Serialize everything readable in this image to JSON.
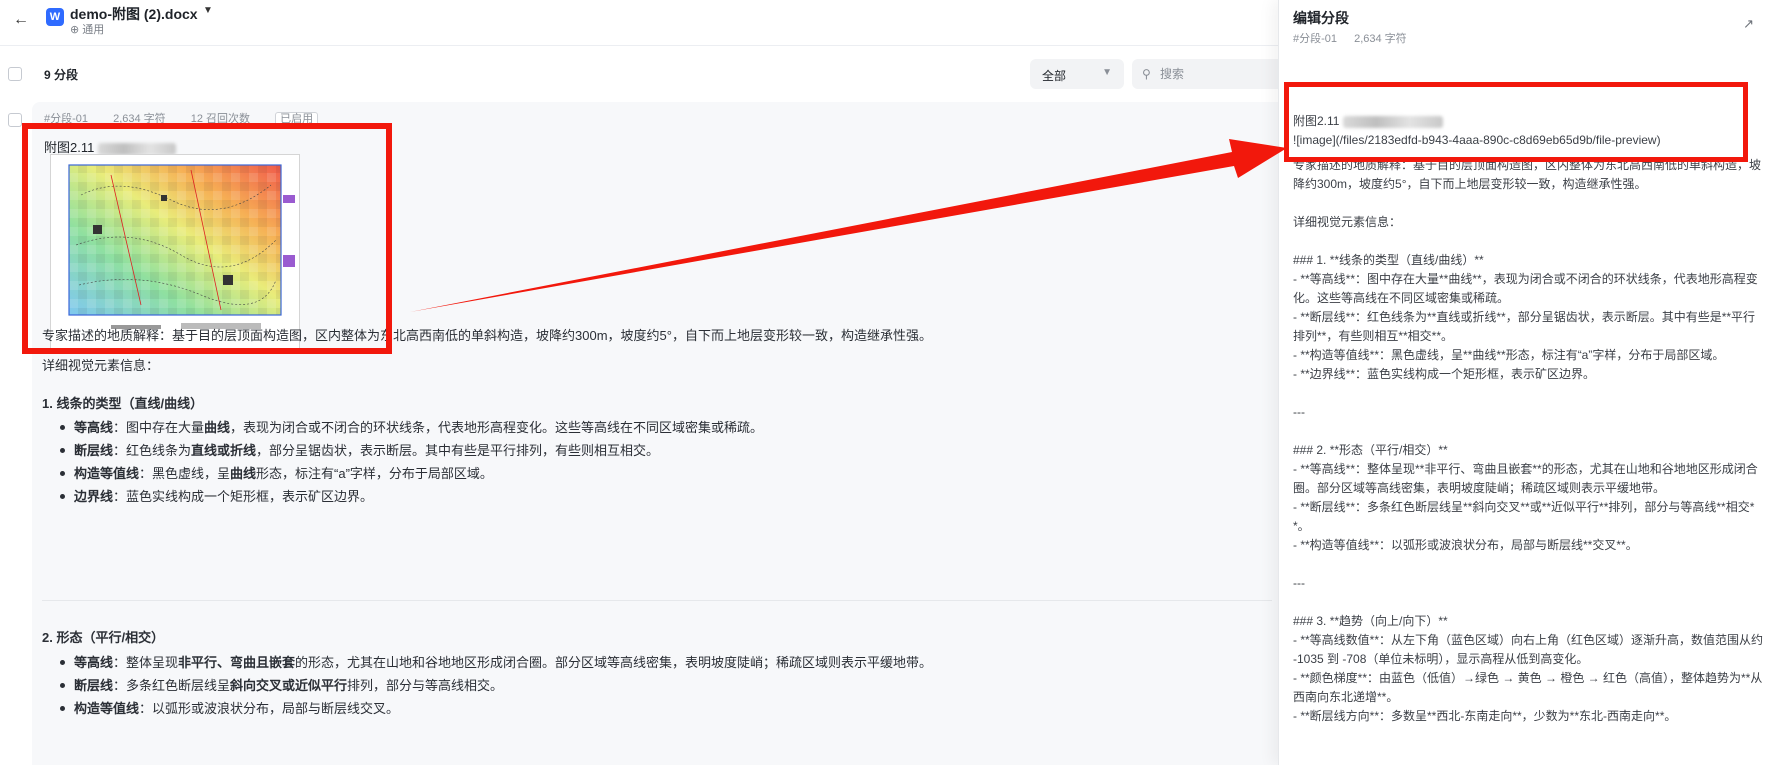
{
  "header": {
    "back_icon": "arrow-left-icon",
    "doc_icon_letter": "W",
    "doc_title": "demo-附图 (2).docx",
    "doc_subtitle": "⊕ 通用"
  },
  "list": {
    "segment_count": "9 分段",
    "filter_value": "全部",
    "search_placeholder": "搜索"
  },
  "segment": {
    "meta": {
      "id": "#分段-01",
      "chars": "2,634 字符",
      "recalls": "12 召回次数",
      "status": "已启用"
    },
    "caption": "附图2.11",
    "description": "专家描述的地质解释：基于目的层顶面构造图，区内整体为东北高西南低的单斜构造，坡降约300m，坡度约5°，自下而上地层变形较一致，构造继承性强。",
    "detail_title": "详细视觉元素信息：",
    "section1_title": "1. 线条的类型（直线/曲线）",
    "section1_items": [
      {
        "term": "等高线",
        "pre": "：图中存在大量",
        "bold": "曲线",
        "post": "，表现为闭合或不闭合的环状线条，代表地形高程变化。这些等高线在不同区域密集或稀疏。"
      },
      {
        "term": "断层线",
        "pre": "：红色线条为",
        "bold": "直线或折线",
        "post": "，部分呈锯齿状，表示断层。其中有些是平行排列，有些则相互相交。"
      },
      {
        "term": "构造等值线",
        "pre": "：黑色虚线，呈",
        "bold": "曲线",
        "post": "形态，标注有“a”字样，分布于局部区域。"
      },
      {
        "term": "边界线",
        "pre": "：蓝色实线构成一个矩形框，表示矿区边界。",
        "bold": "",
        "post": ""
      }
    ],
    "section2_title": "2. 形态（平行/相交）",
    "section2_items": [
      {
        "term": "等高线",
        "pre": "：整体呈现",
        "bold": "非平行、弯曲且嵌套",
        "post": "的形态，尤其在山地和谷地地区形成闭合圈。部分区域等高线密集，表明坡度陡峭；稀疏区域则表示平缓地带。"
      },
      {
        "term": "断层线",
        "pre": "：多条红色断层线呈",
        "bold": "斜向交叉或近似平行",
        "post": "排列，部分与等高线相交。"
      },
      {
        "term": "构造等值线",
        "pre": "：以弧形或波浪状分布，局部与断层线交叉。",
        "bold": "",
        "post": ""
      }
    ]
  },
  "panel": {
    "title": "编辑分段",
    "segment_id": "#分段-01",
    "chars": "2,634 字符",
    "expand_icon": "expand-icon",
    "lines": [
      "附图2.11",
      "![image](/files/2183edfd-b943-4aaa-890c-c8d69eb65d9b/file-preview)",
      "专家描述的地质解释：基于目的层顶面构造图，区内整体为东北高西南低的单斜构造，坡降约300m，坡度约5°，自下而上地层变形较一致，构造继承性强。",
      "",
      "详细视觉元素信息：",
      "",
      "### 1. **线条的类型（直线/曲线）**",
      "- **等高线**：图中存在大量**曲线**，表现为闭合或不闭合的环状线条，代表地形高程变化。这些等高线在不同区域密集或稀疏。",
      "- **断层线**：红色线条为**直线或折线**，部分呈锯齿状，表示断层。其中有些是**平行排列**，有些则相互**相交**。",
      "- **构造等值线**：黑色虚线，呈**曲线**形态，标注有“a”字样，分布于局部区域。",
      "- **边界线**：蓝色实线构成一个矩形框，表示矿区边界。",
      "",
      "---",
      "",
      "### 2. **形态（平行/相交）**",
      "- **等高线**：整体呈现**非平行、弯曲且嵌套**的形态，尤其在山地和谷地地区形成闭合圈。部分区域等高线密集，表明坡度陡峭；稀疏区域则表示平缓地带。",
      "- **断层线**：多条红色断层线呈**斜向交叉**或**近似平行**排列，部分与等高线**相交**。",
      "- **构造等值线**：以弧形或波浪状分布，局部与断层线**交叉**。",
      "",
      "---",
      "",
      "### 3. **趋势（向上/向下）**",
      "- **等高线数值**：从左下角（蓝色区域）向右上角（红色区域）逐渐升高，数值范围从约 -1035 到 -708（单位未标明），显示高程从低到高变化。",
      "- **颜色梯度**：由蓝色（低值）→绿色 → 黄色 → 橙色 → 红色（高值），整体趋势为**从西南向东北递增**。",
      "- **断层线方向**：多数呈**西北-东南走向**，少数为**东北-西南走向**。"
    ]
  },
  "annotations": {
    "highlight_color": "#f2180c"
  }
}
